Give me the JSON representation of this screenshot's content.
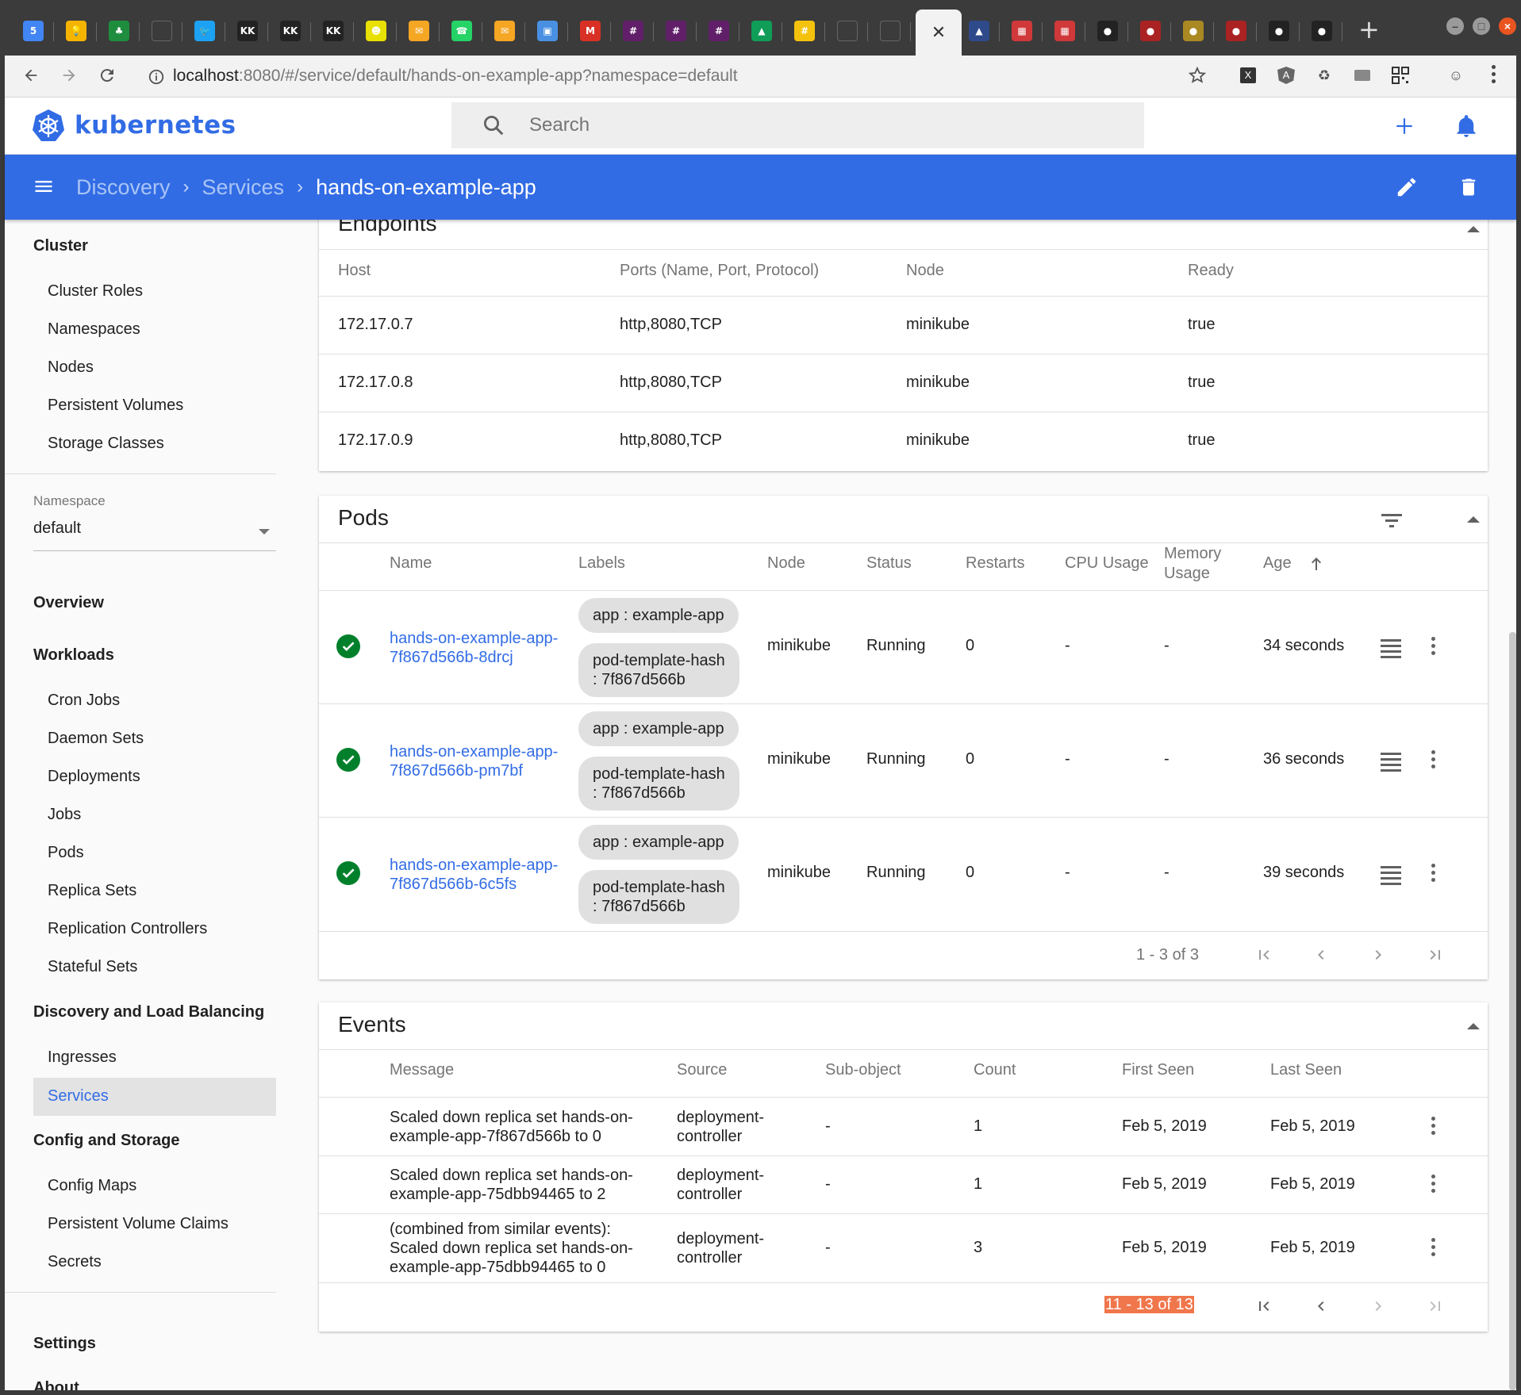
{
  "browser": {
    "tabs": [
      {
        "name": "calendar-tab",
        "glyph": "5",
        "color": "#4285f4"
      },
      {
        "name": "keep-tab",
        "glyph": "💡",
        "color": "#f4b400"
      },
      {
        "name": "tree-tab",
        "glyph": "♣",
        "color": "#1e8e3e"
      },
      {
        "name": "blank-tab-1",
        "glyph": "",
        "color": "#555555"
      },
      {
        "name": "twitter-tab",
        "glyph": "🐦",
        "color": "#1da1f2"
      },
      {
        "name": "kkcd-tab-1",
        "glyph": "KK",
        "color": "#222222"
      },
      {
        "name": "kkcd-tab-2",
        "glyph": "KK",
        "color": "#222222"
      },
      {
        "name": "kkcd-tab-3",
        "glyph": "KK",
        "color": "#222222"
      },
      {
        "name": "ghost-tab",
        "glyph": "☻",
        "color": "#e8e000"
      },
      {
        "name": "mail-tab-1",
        "glyph": "✉",
        "color": "#f5a623"
      },
      {
        "name": "whatsapp-tab",
        "glyph": "☎",
        "color": "#25d366"
      },
      {
        "name": "mail-tab-2",
        "glyph": "✉",
        "color": "#f5a623"
      },
      {
        "name": "image-tab",
        "glyph": "▣",
        "color": "#4a90e2"
      },
      {
        "name": "gmail-tab",
        "glyph": "M",
        "color": "#d93025"
      },
      {
        "name": "slack-tab-1",
        "glyph": "#",
        "color": "#611f69"
      },
      {
        "name": "slack-tab-2",
        "glyph": "#",
        "color": "#611f69"
      },
      {
        "name": "slack-tab-3",
        "glyph": "#",
        "color": "#611f69"
      },
      {
        "name": "drive-tab",
        "glyph": "▲",
        "color": "#0f9d58"
      },
      {
        "name": "hash-tab",
        "glyph": "#",
        "color": "#f4c20d"
      },
      {
        "name": "blank-tab-2",
        "glyph": "",
        "color": "#555555"
      },
      {
        "name": "blank-tab-3",
        "glyph": "",
        "color": "#555555"
      },
      {
        "name": "active-tab",
        "glyph": "✕",
        "color": "active"
      },
      {
        "name": "mountain-tab",
        "glyph": "▲",
        "color": "#2f4a8a"
      },
      {
        "name": "grid-tab-1",
        "glyph": "▦",
        "color": "#d0383a"
      },
      {
        "name": "grid-tab-2",
        "glyph": "▦",
        "color": "#d0383a"
      },
      {
        "name": "github-tab-1",
        "glyph": "●",
        "color": "#222222"
      },
      {
        "name": "github-tab-2",
        "glyph": "●",
        "color": "#aa2222"
      },
      {
        "name": "github-tab-3",
        "glyph": "●",
        "color": "#aa8822"
      },
      {
        "name": "github-tab-4",
        "glyph": "●",
        "color": "#aa2222"
      },
      {
        "name": "github-tab-5",
        "glyph": "●",
        "color": "#222222"
      },
      {
        "name": "github-tab-6",
        "glyph": "●",
        "color": "#222222"
      }
    ],
    "url_host": "localhost",
    "url_rest": ":8080/#/service/default/hands-on-example-app?namespace=default"
  },
  "app": {
    "logo_text": "kubernetes",
    "search_placeholder": "Search",
    "brand_color": "#326ce5"
  },
  "breadcrumb": {
    "items": [
      "Discovery",
      "Services"
    ],
    "current": "hands-on-example-app"
  },
  "sidebar": {
    "cluster_heading": "Cluster",
    "cluster_items": [
      "Cluster Roles",
      "Namespaces",
      "Nodes",
      "Persistent Volumes",
      "Storage Classes"
    ],
    "namespace_label": "Namespace",
    "namespace_value": "default",
    "overview": "Overview",
    "workloads_heading": "Workloads",
    "workloads_items": [
      "Cron Jobs",
      "Daemon Sets",
      "Deployments",
      "Jobs",
      "Pods",
      "Replica Sets",
      "Replication Controllers",
      "Stateful Sets"
    ],
    "discovery_heading": "Discovery and Load Balancing",
    "discovery_items": [
      "Ingresses",
      "Services"
    ],
    "config_heading": "Config and Storage",
    "config_items": [
      "Config Maps",
      "Persistent Volume Claims",
      "Secrets"
    ],
    "settings": "Settings",
    "about": "About"
  },
  "endpoints": {
    "title": "Endpoints",
    "headers": [
      "Host",
      "Ports (Name, Port, Protocol)",
      "Node",
      "Ready"
    ],
    "rows": [
      [
        "172.17.0.7",
        "http,8080,TCP",
        "minikube",
        "true"
      ],
      [
        "172.17.0.8",
        "http,8080,TCP",
        "minikube",
        "true"
      ],
      [
        "172.17.0.9",
        "http,8080,TCP",
        "minikube",
        "true"
      ]
    ]
  },
  "pods": {
    "title": "Pods",
    "headers": {
      "name": "Name",
      "labels": "Labels",
      "node": "Node",
      "status": "Status",
      "restarts": "Restarts",
      "cpu": "CPU Usage",
      "memory_1": "Memory",
      "memory_2": "Usage",
      "age": "Age"
    },
    "rows": [
      {
        "name_1": "hands-on-example-app-",
        "name_2": "7f867d566b-8drcj",
        "label_1": "app : example-app",
        "label_2a": "pod-template-hash",
        "label_2b": ": 7f867d566b",
        "node": "minikube",
        "status": "Running",
        "restarts": "0",
        "cpu": "-",
        "memory": "-",
        "age": "34 seconds"
      },
      {
        "name_1": "hands-on-example-app-",
        "name_2": "7f867d566b-pm7bf",
        "label_1": "app : example-app",
        "label_2a": "pod-template-hash",
        "label_2b": ": 7f867d566b",
        "node": "minikube",
        "status": "Running",
        "restarts": "0",
        "cpu": "-",
        "memory": "-",
        "age": "36 seconds"
      },
      {
        "name_1": "hands-on-example-app-",
        "name_2": "7f867d566b-6c5fs",
        "label_1": "app : example-app",
        "label_2a": "pod-template-hash",
        "label_2b": ": 7f867d566b",
        "node": "minikube",
        "status": "Running",
        "restarts": "0",
        "cpu": "-",
        "memory": "-",
        "age": "39 seconds"
      }
    ],
    "pagination": "1 - 3 of 3"
  },
  "events": {
    "title": "Events",
    "headers": [
      "Message",
      "Source",
      "Sub-object",
      "Count",
      "First Seen",
      "Last Seen"
    ],
    "rows": [
      {
        "msg": [
          "Scaled down replica set hands-on-",
          "example-app-7f867d566b to 0"
        ],
        "src": [
          "deployment-",
          "controller"
        ],
        "sub": "-",
        "count": "1",
        "first": "Feb 5, 2019",
        "last": "Feb 5, 2019"
      },
      {
        "msg": [
          "Scaled down replica set hands-on-",
          "example-app-75dbb94465 to 2"
        ],
        "src": [
          "deployment-",
          "controller"
        ],
        "sub": "-",
        "count": "1",
        "first": "Feb 5, 2019",
        "last": "Feb 5, 2019"
      },
      {
        "msg": [
          "(combined from similar events):",
          "Scaled down replica set hands-on-",
          "example-app-75dbb94465 to 0"
        ],
        "src": [
          "deployment-",
          "controller"
        ],
        "sub": "-",
        "count": "3",
        "first": "Feb 5, 2019",
        "last": "Feb 5, 2019"
      }
    ],
    "pagination": "11 - 13 of 13"
  }
}
